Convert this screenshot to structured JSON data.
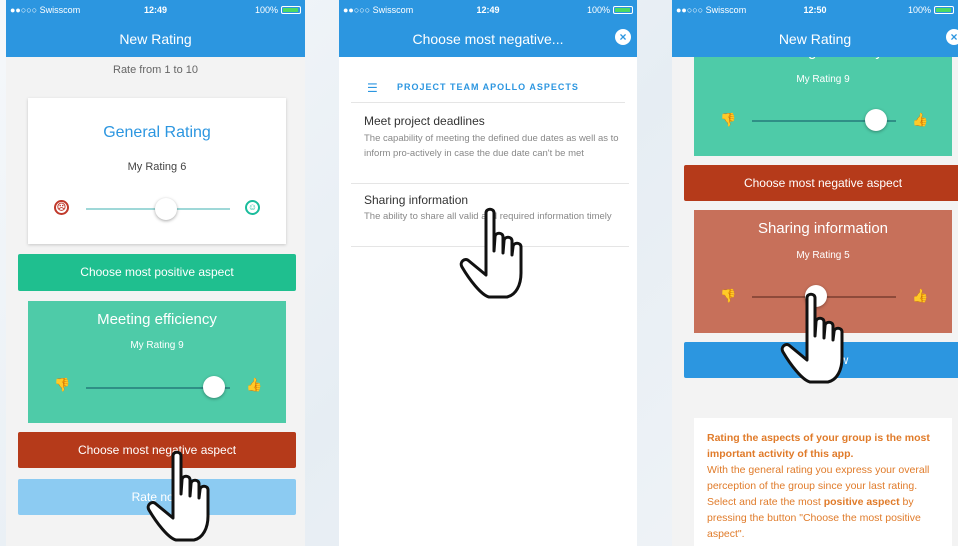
{
  "status": {
    "carrier": "●●○○○ Swisscom",
    "battery": "100%"
  },
  "screens": [
    {
      "time": "12:49",
      "nav_title": "New Rating",
      "rate_from": "Rate from 1 to 10",
      "general_title": "General Rating",
      "my_rating": "My Rating 6",
      "general_value": 6,
      "positive_button": "Choose most positive aspect",
      "efficiency_title": "Meeting efficiency",
      "efficiency_rating": "My Rating 9",
      "efficiency_value": 9,
      "negative_button": "Choose most negative aspect",
      "rate_button": "Rate now"
    },
    {
      "time": "12:49",
      "nav_title": "Choose most negative...",
      "section_header": "PROJECT TEAM APOLLO ASPECTS",
      "items": [
        {
          "title": "Meet project deadlines",
          "desc": "The capability of meeting the defined due dates as well as to inform pro-actively in case the due date can't be met"
        },
        {
          "title": "Sharing information",
          "desc": "The ability to share all valid and required information timely"
        }
      ]
    },
    {
      "time": "12:50",
      "nav_title": "New Rating",
      "efficiency_title": "Meeting efficiency",
      "efficiency_rating": "My Rating 9",
      "negative_button": "Choose most negative aspect",
      "sharing_title": "Sharing information",
      "sharing_rating": "My Rating 5",
      "sharing_value": 5,
      "rate_button": "Rate now",
      "info_bold1": "Rating the aspects of your group is the most important activity of this app.",
      "info_p1": "With the general rating you express your overall perception of the group since your last rating.",
      "info_p2a": "Select and rate the most ",
      "info_p2b": "positive aspect",
      "info_p2c": " by pressing the button \"Choose the most positive aspect\"."
    }
  ],
  "colors": {
    "brand_blue": "#2c96e0",
    "teal": "#4ecba8",
    "red": "#b53a1a",
    "salmon": "#c7705a",
    "orange_text": "#e07b2a"
  }
}
